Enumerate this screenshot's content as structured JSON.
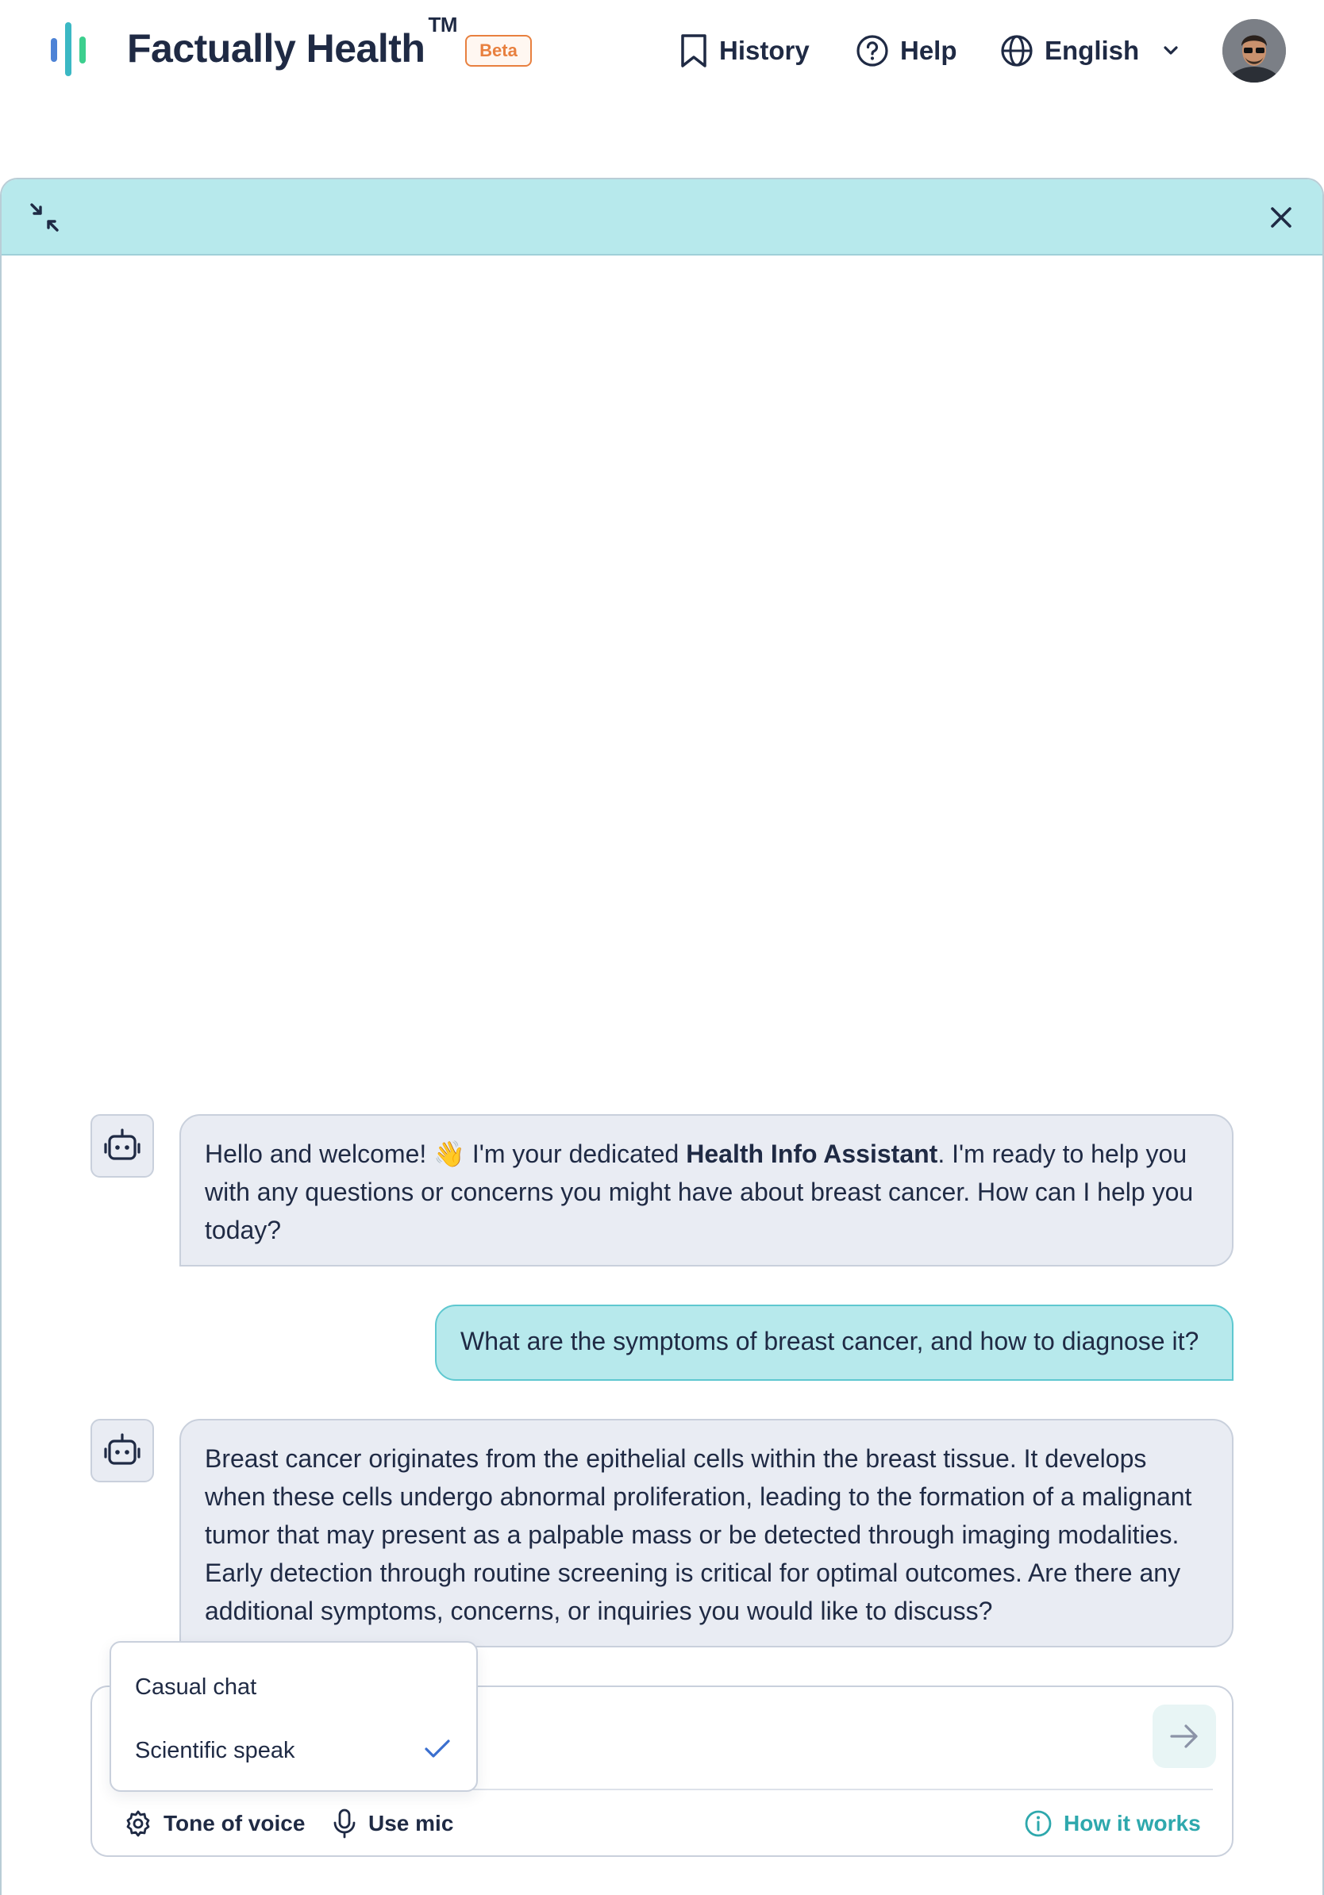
{
  "header": {
    "brand": "Factually Health",
    "trademark": "TM",
    "beta_badge": "Beta",
    "nav": {
      "history": "History",
      "help": "Help",
      "language": "English"
    },
    "icons": {
      "history": "bookmark-icon",
      "help": "question-circle-icon",
      "language": "globe-icon",
      "language_dropdown": "chevron-down-icon"
    },
    "logo_colors": [
      "#4d83d6",
      "#3bb8c4",
      "#3ccf8e"
    ]
  },
  "chat": {
    "top_bar_icons": {
      "collapse": "collapse-arrows-icon",
      "close": "close-icon"
    },
    "messages": [
      {
        "role": "assistant",
        "icon": "robot-icon",
        "text_before": "Hello and welcome! 👋 I'm your dedicated ",
        "text_bold": "Health Info Assistant",
        "text_after": ". I'm ready to help you with any questions or concerns you might have about breast cancer. How can I help you today?"
      },
      {
        "role": "user",
        "text": "What are the symptoms of breast cancer, and how to diagnose it?"
      },
      {
        "role": "assistant",
        "icon": "robot-icon",
        "text": "Breast cancer originates from the epithelial cells within the breast tissue. It develops when these cells undergo abnormal proliferation, leading to the formation of a malignant tumor that may present as a palpable mass or be detected through imaging modalities. Early detection through routine screening is critical for optimal outcomes. Are there any additional symptoms, concerns, or inquiries you would like to discuss?"
      }
    ]
  },
  "composer": {
    "placeholder": "...?",
    "send_icon": "arrow-right-icon",
    "tools": {
      "tone": "Tone of voice",
      "mic": "Use mic",
      "how": "How it works"
    },
    "tool_icons": {
      "tone": "gear-icon",
      "mic": "microphone-icon",
      "how": "info-icon"
    }
  },
  "tone_menu": {
    "options": [
      "Casual chat",
      "Scientific speak"
    ],
    "selected": "Scientific speak",
    "check_icon": "checkmark-icon"
  },
  "colors": {
    "accent": "#b7e9ec",
    "accent_text": "#2ea8ad",
    "beta": "#e8803f",
    "text": "#1f2a44",
    "bot_bubble": "#e9ecf3"
  }
}
